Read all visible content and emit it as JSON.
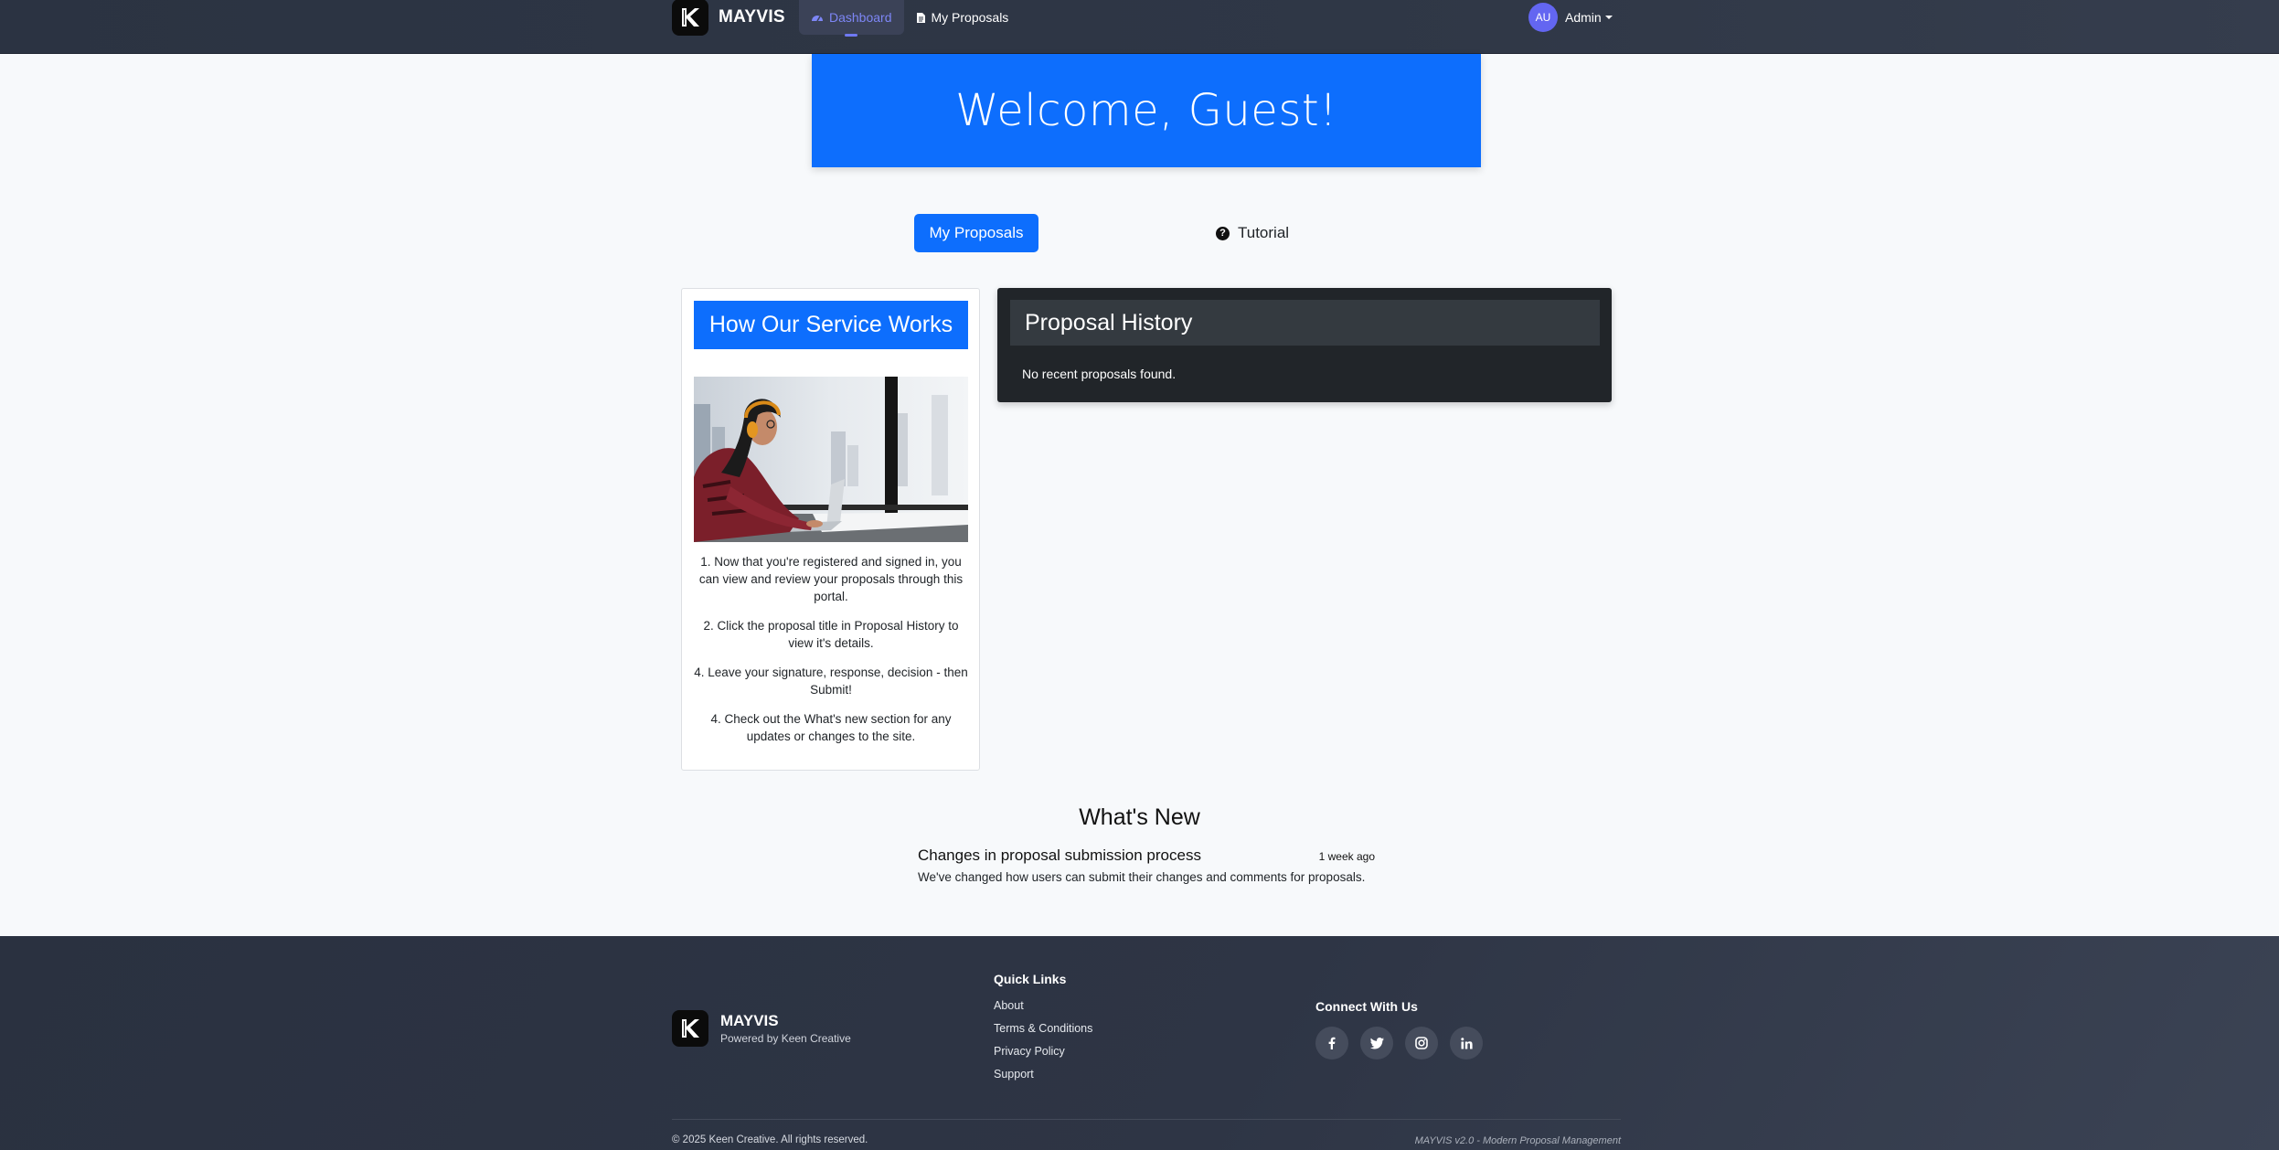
{
  "nav": {
    "brand": "MAYVIS",
    "links": [
      {
        "label": "Dashboard",
        "icon": "dashboard-icon"
      },
      {
        "label": "My Proposals",
        "icon": "document-icon"
      }
    ],
    "user": {
      "initials": "AU",
      "name": "Admin"
    }
  },
  "welcome": {
    "text": "Welcome, Guest!"
  },
  "actions": {
    "proposals_label": "My Proposals",
    "tutorial_label": "Tutorial"
  },
  "service": {
    "title": "How Our Service Works",
    "steps": [
      "1. Now that you're registered and signed in, you can view and review your proposals through this portal.",
      "2. Click the proposal title in Proposal History to view it's details.",
      "4. Leave your signature, response, decision - then Submit!",
      "4. Check out the What's new section for any updates or changes to the site."
    ]
  },
  "history": {
    "title": "Proposal History",
    "empty": "No recent proposals found."
  },
  "whats_new": {
    "title": "What's New",
    "items": [
      {
        "title": "Changes in proposal submission process",
        "time": "1 week ago",
        "body": "We've changed how users can submit their changes and comments for proposals."
      }
    ]
  },
  "footer": {
    "brand": "MAYVIS",
    "tagline": "Powered by Keen Creative",
    "quick_links_title": "Quick Links",
    "quick_links": [
      "About",
      "Terms & Conditions",
      "Privacy Policy",
      "Support"
    ],
    "connect_title": "Connect With Us",
    "socials": [
      "facebook-icon",
      "twitter-icon",
      "instagram-icon",
      "linkedin-icon"
    ],
    "copyright": "© 2025 Keen Creative. All rights reserved.",
    "version": "MAYVIS v2.0 - Modern Proposal Management"
  },
  "colors": {
    "primary": "#0d6efd",
    "nav_bg": "#2f3746",
    "card_dark": "#212529",
    "avatar": "#6366f1"
  }
}
